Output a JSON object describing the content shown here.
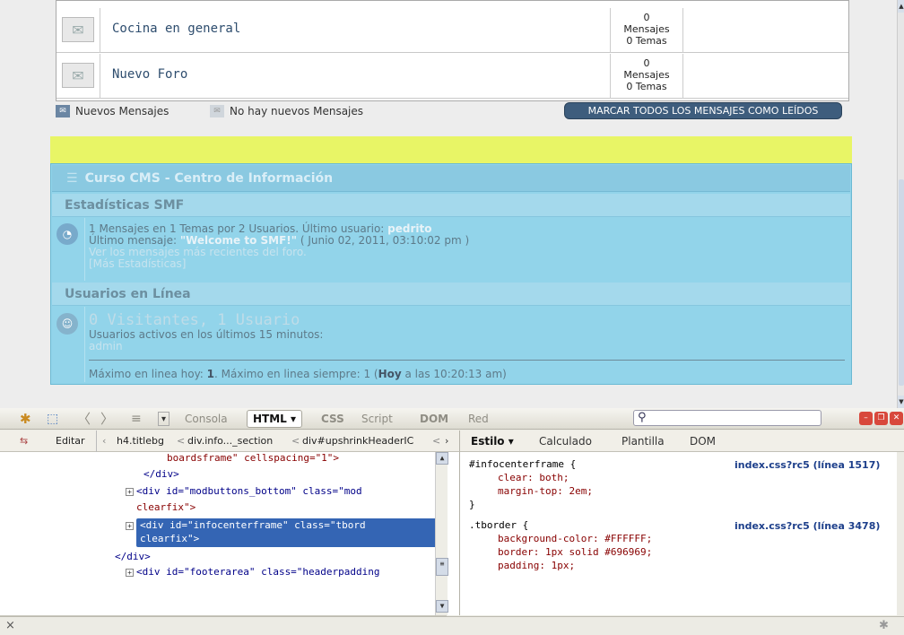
{
  "boards": [
    {
      "name": "Cocina en general",
      "posts": "0",
      "posts_label": "Mensajes",
      "topics": "0 Temas"
    },
    {
      "name": "Nuevo Foro",
      "posts": "0",
      "posts_label": "Mensajes",
      "topics": "0 Temas"
    }
  ],
  "legend": {
    "new_posts": "Nuevos Mensajes",
    "no_new_posts": "No hay nuevos Mensajes",
    "mark_all_read": "MARCAR TODOS LOS MENSAJES COMO LEÍDOS"
  },
  "infocenter": {
    "title": "Curso CMS - Centro de Información",
    "stats_title": "Estadísticas SMF",
    "stats_line1_prefix": "1 Mensajes en 1 Temas por 2 Usuarios. Último usuario: ",
    "stats_latest_member": "pedrito",
    "stats_line2_prefix": "Último mensaje: ",
    "stats_latest_post": "\"Welcome to SMF!\"",
    "stats_line2_suffix": " ( Junio 02, 2011, 03:10:02 pm )",
    "stats_recent_link": "Ver los mensajes más recientes del foro.",
    "stats_more_link": "[Más Estadísticas]",
    "online_title": "Usuarios en Línea",
    "online_count": "0 Visitantes, 1 Usuario",
    "online_active": "Usuarios activos en los últimos 15 minutos:",
    "online_user": "admin",
    "online_max_prefix": "Máximo en linea hoy: ",
    "online_max_today": "1",
    "online_max_mid": ". Máximo en linea siempre: 1 (",
    "online_max_when": "Hoy",
    "online_max_suffix": " a las 10:20:13 am)"
  },
  "firebug": {
    "tabs": [
      "Consola",
      "HTML ▾",
      "CSS",
      "Script",
      "DOM",
      "Red"
    ],
    "edit_label": "Editar",
    "breadcrumb": [
      "h4.titlebg",
      "div.info..._section",
      "div#upshrinkHeaderIC"
    ],
    "right_tabs": [
      "Estilo ▾",
      "Calculado",
      "Plantilla",
      "DOM"
    ],
    "html_lines": [
      {
        "pre": "boardsframe\" cellspacing=\"1\">",
        "kind": "val"
      },
      {
        "pre": "</div>",
        "kind": "tag"
      },
      {
        "pre": "<div id=\"modbuttons_bottom\" class=\"mod",
        "kind": "mixed"
      },
      {
        "pre": "clearfix\">",
        "kind": "val"
      },
      {
        "pre": "<div id=\"infocenterframe\" class=\"tbord",
        "kind": "sel"
      },
      {
        "pre": "clearfix\">",
        "kind": "sel"
      },
      {
        "pre": "</div>",
        "kind": "tag"
      },
      {
        "pre": "<div id=\"footerarea\" class=\"headerpadding",
        "kind": "mixed"
      }
    ],
    "css_rule1": {
      "selector": "#infocenterframe {",
      "p1": "clear: both;",
      "p2": "margin-top: 2em;",
      "source": "index.css?rc5 (línea 1517)"
    },
    "css_rule2": {
      "selector": ".tborder {",
      "p1": "background-color: #FFFFFF;",
      "p2": "border: 1px solid #696969;",
      "p3": "padding: 1px;",
      "source": "index.css?rc5 (línea 3478)"
    },
    "close": "×"
  }
}
